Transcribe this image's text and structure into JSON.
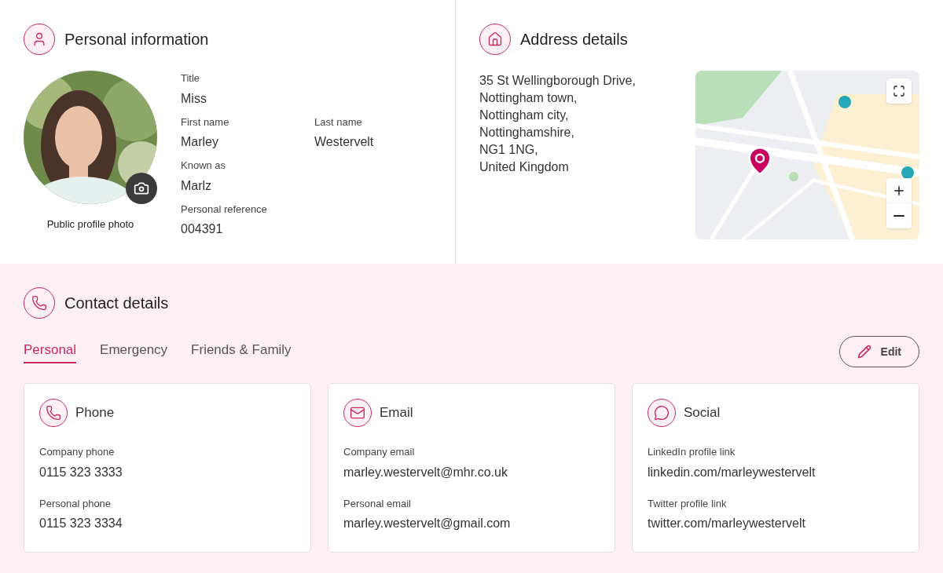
{
  "personal": {
    "title": "Personal information",
    "photo": {
      "kind": "picture",
      "caption": "Public profile photo"
    },
    "rows": [
      [
        {
          "label": "Title",
          "value": "Miss"
        }
      ],
      [
        {
          "label": "First name",
          "value": "Marley"
        },
        {
          "label": "Last name",
          "value": "Westervelt"
        }
      ],
      [
        {
          "label": "Known as",
          "value": "Marlz"
        }
      ],
      [
        {
          "label": "Personal reference",
          "value": "004391"
        }
      ]
    ]
  },
  "address": {
    "title": "Address details",
    "lines": [
      "35 St Wellingborough Drive,",
      "Nottingham town,",
      "Nottingham city,",
      "Nottinghamshire,",
      "NG1 1NG,",
      "United Kingdom"
    ]
  },
  "contact": {
    "title": "Contact details",
    "tabs": [
      {
        "label": "Personal",
        "selected": true
      },
      {
        "label": "Emergency",
        "selected": false
      },
      {
        "label": "Friends & Family",
        "selected": false
      }
    ],
    "edit_button": "Edit",
    "cards": [
      {
        "kind": "phone",
        "title": "Phone",
        "fields": [
          {
            "label": "Company phone",
            "value": "0115 323 3333"
          },
          {
            "label": "Personal phone",
            "value": "0115 323 3334"
          }
        ]
      },
      {
        "kind": "email",
        "title": "Email",
        "fields": [
          {
            "label": "Company email",
            "value": "marley.westervelt@mhr.co.uk"
          },
          {
            "label": "Personal email",
            "value": "marley.westervelt@gmail.com"
          }
        ]
      },
      {
        "kind": "social",
        "title": "Social",
        "fields": [
          {
            "label": "LinkedIn profile link",
            "value": "linkedin.com/marleywestervelt"
          },
          {
            "label": "Twitter profile link",
            "value": "twitter.com/marleywestervelt"
          }
        ]
      }
    ]
  }
}
